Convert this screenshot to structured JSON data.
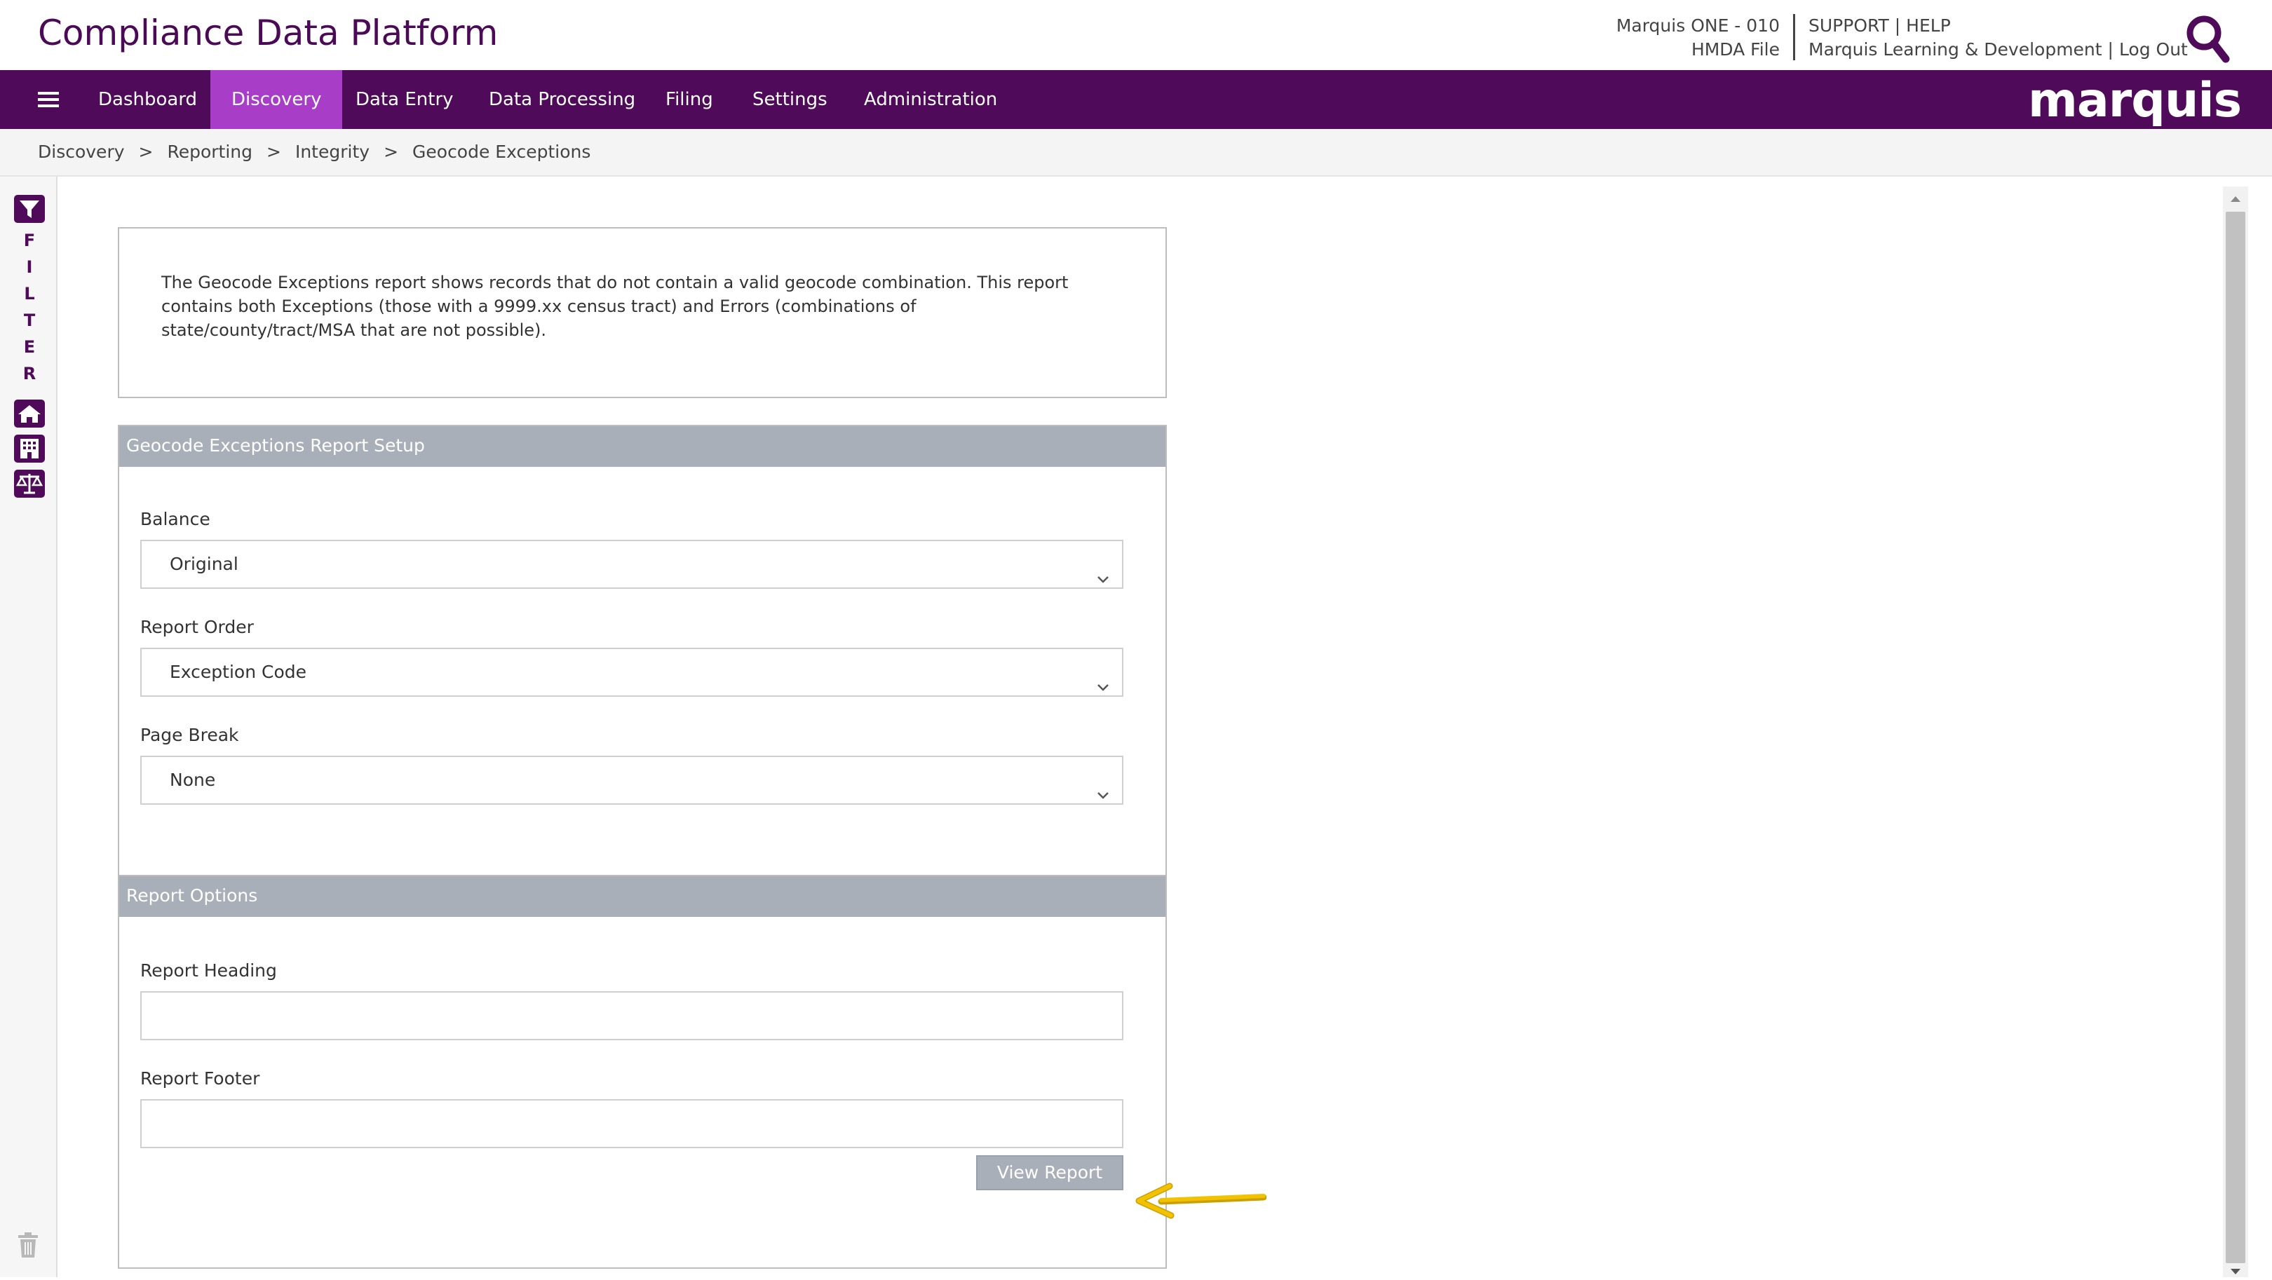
{
  "header": {
    "title": "Compliance Data Platform",
    "account_line1": "Marquis ONE - 010",
    "account_line2": "HMDA File",
    "support": "SUPPORT",
    "help": "HELP",
    "org": "Marquis Learning & Development",
    "logout": "Log Out",
    "link_sep": "|"
  },
  "nav": {
    "items": [
      "Dashboard",
      "Discovery",
      "Data Entry",
      "Data Processing",
      "Filing",
      "Settings",
      "Administration"
    ],
    "active": "Discovery",
    "logo": "marquis"
  },
  "breadcrumb": {
    "items": [
      "Discovery",
      "Reporting",
      "Integrity",
      "Geocode Exceptions"
    ],
    "sep": ">"
  },
  "sidebar": {
    "filter_letters": [
      "F",
      "I",
      "L",
      "T",
      "E",
      "R"
    ],
    "icons": [
      "filter-icon",
      "home-icon",
      "building-icon",
      "scales-icon",
      "trash-icon"
    ]
  },
  "description": "The Geocode Exceptions report shows records that do not contain a valid geocode combination. This report contains both Exceptions (those with a 9999.xx census tract) and Errors (combinations of state/county/tract/MSA that are not possible).",
  "setup": {
    "heading": "Geocode Exceptions Report Setup",
    "balance_label": "Balance",
    "balance_value": "Original",
    "order_label": "Report Order",
    "order_value": "Exception Code",
    "pagebreak_label": "Page Break",
    "pagebreak_value": "None"
  },
  "options": {
    "heading": "Report Options",
    "heading_label": "Report Heading",
    "heading_value": "",
    "footer_label": "Report Footer",
    "footer_value": "",
    "view_button": "View Report"
  },
  "colors": {
    "brand_purple": "#4f0a5a",
    "active_tab": "#a83ec8",
    "panel_header": "#a8afb8",
    "annotation_arrow": "#f2c200"
  }
}
